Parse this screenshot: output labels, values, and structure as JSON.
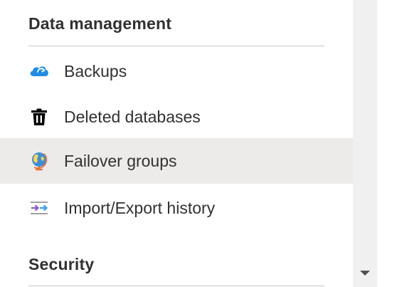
{
  "sections": [
    {
      "title": "Data management",
      "items": [
        {
          "label": "Backups",
          "icon": "cloud-backup-icon",
          "selected": false
        },
        {
          "label": "Deleted databases",
          "icon": "trash-icon",
          "selected": false
        },
        {
          "label": "Failover groups",
          "icon": "globe-icon",
          "selected": true
        },
        {
          "label": "Import/Export history",
          "icon": "import-export-icon",
          "selected": false
        }
      ]
    },
    {
      "title": "Security",
      "items": []
    }
  ],
  "colors": {
    "text": "#323130",
    "selected_background": "#edebe9",
    "divider": "#c8c6c4",
    "cloud_blue": "#1f8ce6",
    "arrow_purple": "#8661c5",
    "arrow_blue": "#3ea0f0",
    "scrollbar_track": "#f0f0f0"
  }
}
